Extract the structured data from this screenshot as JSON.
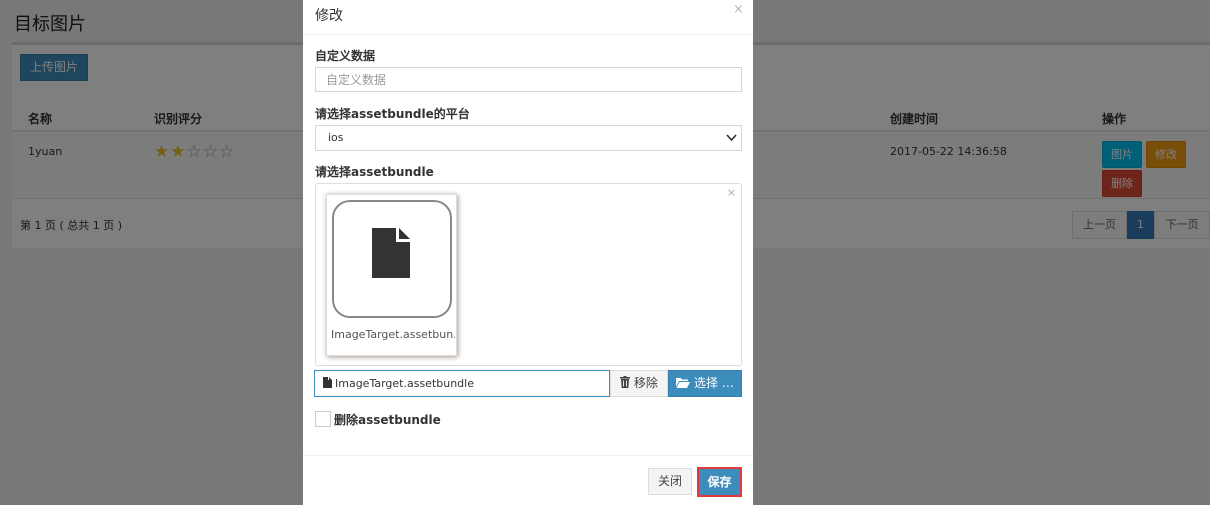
{
  "page": {
    "title": "目标图片",
    "upload_button": "上传图片",
    "table": {
      "headers": {
        "name": "名称",
        "rating": "识别评分",
        "created": "创建时间",
        "actions": "操作"
      },
      "rows": [
        {
          "name": "1yuan",
          "stars_filled": 2,
          "stars_total": 5,
          "created": "2017-05-22 14:36:58",
          "actions": {
            "image": "图片",
            "edit": "修改",
            "delete": "删除"
          }
        }
      ]
    },
    "pager_info": "第 1 页 ( 总共 1 页 )",
    "pagination": {
      "prev": "上一页",
      "current": "1",
      "next": "下一页"
    }
  },
  "modal": {
    "title": "修改",
    "close_glyph": "×",
    "custom_data": {
      "label": "自定义数据",
      "placeholder": "自定义数据",
      "value": ""
    },
    "platform": {
      "label": "请选择assetbundle的平台",
      "selected": "ios"
    },
    "assetbundle": {
      "label": "请选择assetbundle",
      "clear_glyph": "×",
      "thumb_caption": "ImageTarget.assetbun...",
      "file_caption": "ImageTarget.assetbundle",
      "remove_label": "移除",
      "browse_label": "选择 …"
    },
    "delete_checkbox": {
      "label": "删除assetbundle",
      "checked": false
    },
    "footer": {
      "close_label": "关闭",
      "save_label": "保存"
    }
  },
  "colors": {
    "primary": "#3c8dbc",
    "info": "#00c0ef",
    "warning": "#f39c12",
    "danger": "#dd4b39",
    "highlight": "#e23a3a",
    "star": "#e9c12a"
  },
  "icons": [
    "file-icon",
    "trash-icon",
    "folder-open-icon",
    "chevron-down-icon",
    "close-icon",
    "star-icon"
  ]
}
